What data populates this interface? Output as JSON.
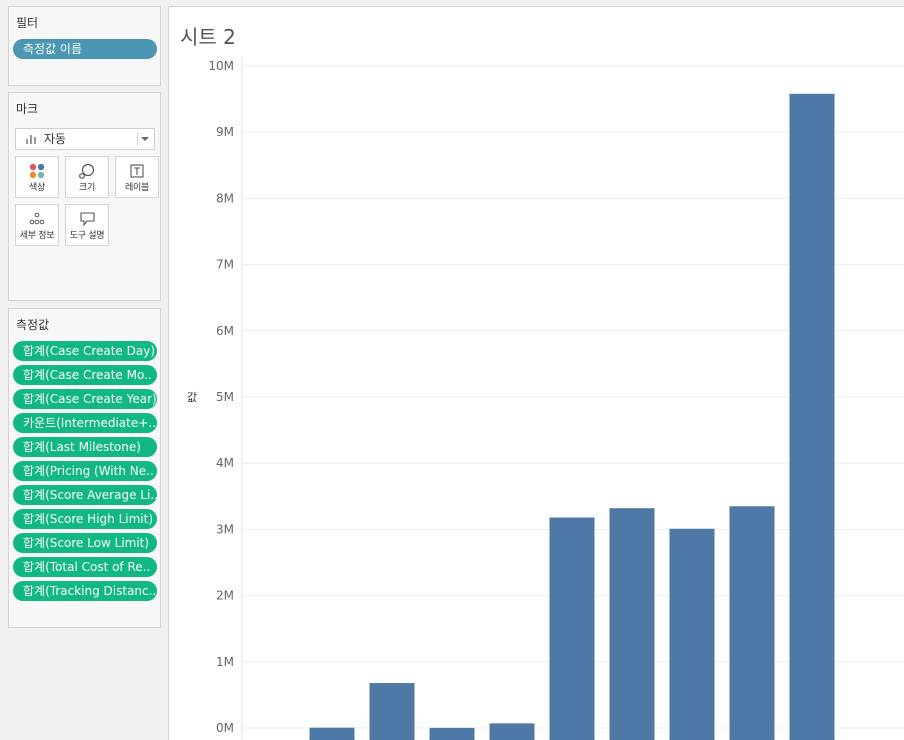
{
  "filters_panel": {
    "title": "필터",
    "pills": [
      "측정값 이름"
    ]
  },
  "marks_panel": {
    "title": "마크",
    "mark_type": "자동",
    "buttons": [
      {
        "label": "색상",
        "icon": "color-dots-icon"
      },
      {
        "label": "크기",
        "icon": "size-icon"
      },
      {
        "label": "레이블",
        "icon": "text-label-icon"
      },
      {
        "label": "세부 정보",
        "icon": "detail-dots-icon"
      },
      {
        "label": "도구 설명",
        "icon": "tooltip-icon"
      }
    ]
  },
  "measures_panel": {
    "title": "측정값",
    "pills": [
      "합계(Case Create Day)",
      "합계(Case Create Mo..",
      "합계(Case Create Year)",
      "카운트(Intermediate+..",
      "합계(Last Milestone)",
      "합계(Pricing (With Ne..",
      "합계(Score Average Li..",
      "합계(Score High Limit)",
      "합계(Score Low Limit)",
      "합계(Total Cost of Re..",
      "합계(Tracking Distanc.."
    ]
  },
  "sheet": {
    "title": "시트 2",
    "y_axis_label": "값"
  },
  "chart_data": {
    "type": "bar",
    "ylim": [
      0,
      10000000
    ],
    "y_ticks": [
      {
        "value": 0,
        "label": "0M"
      },
      {
        "value": 1000000,
        "label": "1M"
      },
      {
        "value": 2000000,
        "label": "2M"
      },
      {
        "value": 3000000,
        "label": "3M"
      },
      {
        "value": 4000000,
        "label": "4M"
      },
      {
        "value": 5000000,
        "label": "5M"
      },
      {
        "value": 6000000,
        "label": "6M"
      },
      {
        "value": 7000000,
        "label": "7M"
      },
      {
        "value": 8000000,
        "label": "8M"
      },
      {
        "value": 9000000,
        "label": "9M"
      },
      {
        "value": 10000000,
        "label": "10M"
      }
    ],
    "values": [
      5000,
      680000,
      2000,
      70000,
      3180000,
      3320000,
      3010000,
      3350000,
      9580000
    ],
    "bar_color": "#4e79a7",
    "grid": true
  },
  "colors": {
    "filter_pill": "#4a96b3",
    "measure_pill": "#12b883",
    "bar": "#4e79a7"
  }
}
